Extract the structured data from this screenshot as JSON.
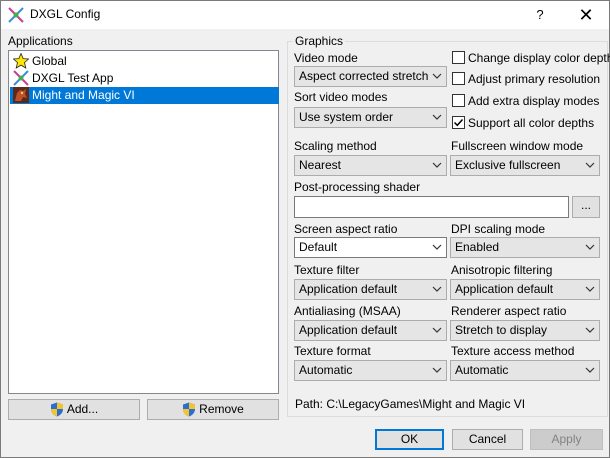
{
  "window": {
    "title": "DXGL Config",
    "help_glyph": "?",
    "close_glyph": "✕"
  },
  "applications": {
    "label": "Applications",
    "items": [
      {
        "label": "Global",
        "icon": "star-icon",
        "selected": false
      },
      {
        "label": "DXGL Test App",
        "icon": "dxgl-icon",
        "selected": false
      },
      {
        "label": "Might and Magic VI",
        "icon": "game-icon",
        "selected": true
      }
    ],
    "add_button": "Add...",
    "remove_button": "Remove"
  },
  "graphics": {
    "group_title": "Graphics",
    "video_mode": {
      "label": "Video mode",
      "value": "Aspect corrected stretch"
    },
    "sort_video_modes": {
      "label": "Sort video modes",
      "value": "Use system order"
    },
    "checkboxes": [
      {
        "label": "Change display color depth",
        "checked": false
      },
      {
        "label": "Adjust primary resolution",
        "checked": false
      },
      {
        "label": "Add extra display modes",
        "checked": false
      },
      {
        "label": "Support all color depths",
        "checked": true
      }
    ],
    "scaling_method": {
      "label": "Scaling method",
      "value": "Nearest"
    },
    "fullscreen_window_mode": {
      "label": "Fullscreen window mode",
      "value": "Exclusive fullscreen"
    },
    "post_processing_shader": {
      "label": "Post-processing shader",
      "value": "",
      "browse": "..."
    },
    "screen_aspect_ratio": {
      "label": "Screen aspect ratio",
      "value": "Default"
    },
    "dpi_scaling_mode": {
      "label": "DPI scaling mode",
      "value": "Enabled"
    },
    "texture_filter": {
      "label": "Texture filter",
      "value": "Application default"
    },
    "anisotropic_filtering": {
      "label": "Anisotropic filtering",
      "value": "Application default"
    },
    "antialiasing": {
      "label": "Antialiasing (MSAA)",
      "value": "Application default"
    },
    "renderer_aspect_ratio": {
      "label": "Renderer aspect ratio",
      "value": "Stretch to display"
    },
    "texture_format": {
      "label": "Texture format",
      "value": "Automatic"
    },
    "texture_access_method": {
      "label": "Texture access method",
      "value": "Automatic"
    },
    "path": "Path:  C:\\LegacyGames\\Might and Magic VI"
  },
  "footer": {
    "ok": "OK",
    "cancel": "Cancel",
    "apply": "Apply"
  },
  "colors": {
    "selection": "#0078d7",
    "window_bg": "#f0f0f0"
  }
}
